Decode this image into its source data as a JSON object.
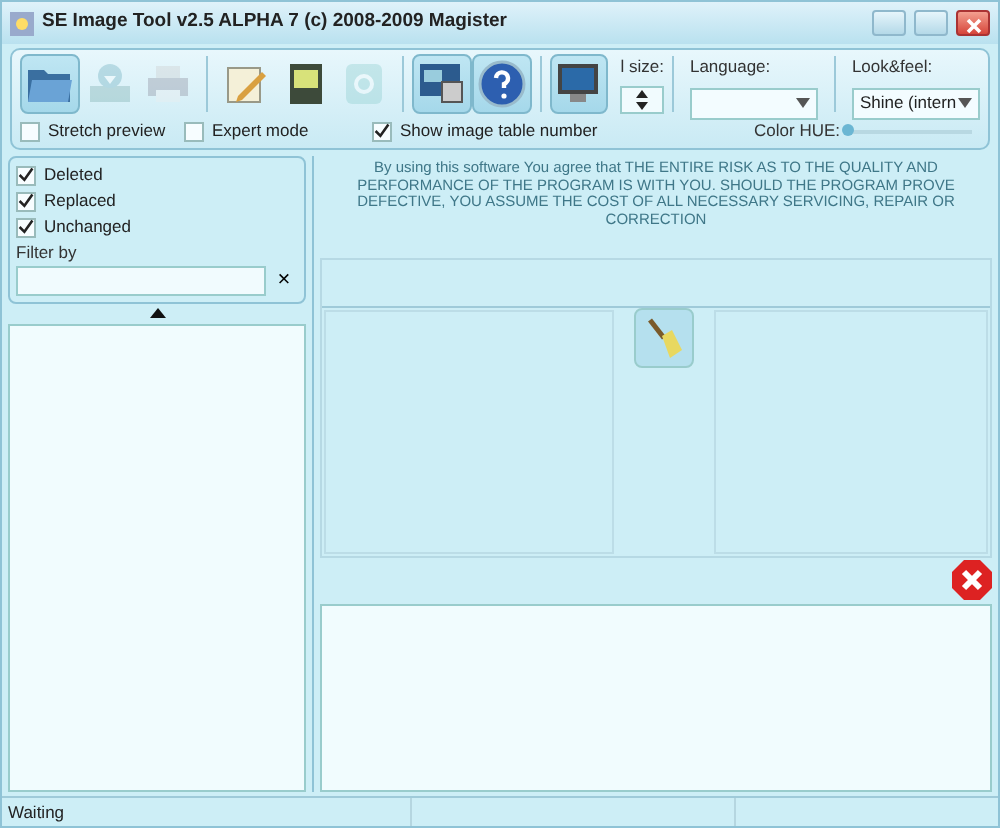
{
  "window": {
    "title": "SE Image Tool v2.5 ALPHA 7 (c) 2008-2009 Magister"
  },
  "toolbar": {
    "groups": [
      [
        {
          "kind": "open",
          "disabled": false,
          "pressed": true
        },
        {
          "kind": "import",
          "disabled": true,
          "pressed": false
        },
        {
          "kind": "print",
          "disabled": true,
          "pressed": false
        }
      ],
      [
        {
          "kind": "edit",
          "disabled": false,
          "pressed": false
        },
        {
          "kind": "save",
          "disabled": false,
          "pressed": false
        },
        {
          "kind": "refresh",
          "disabled": true,
          "pressed": false
        }
      ],
      [
        {
          "kind": "screens",
          "disabled": false,
          "pressed": true
        },
        {
          "kind": "help",
          "disabled": false,
          "pressed": true
        }
      ],
      [
        {
          "kind": "monitor",
          "disabled": false,
          "pressed": true
        }
      ]
    ],
    "size_label": "l size:",
    "language": {
      "label": "Language:"
    },
    "look_and_feel": {
      "label": "Look&feel:",
      "value": "Shine (intern"
    },
    "color_hue": {
      "label": "Color HUE:",
      "level": 0.0
    }
  },
  "options": [
    {
      "label": "Stretch preview",
      "checked": false
    },
    {
      "label": "Expert mode",
      "checked": false
    },
    {
      "label": "Show image table number",
      "checked": true
    }
  ],
  "filters": [
    {
      "label": "Deleted",
      "checked": true
    },
    {
      "label": "Replaced",
      "checked": true
    },
    {
      "label": "Unchanged",
      "checked": true
    }
  ],
  "filter_by": {
    "label": "Filter by",
    "clear": "×"
  },
  "disclaimer": "By using this software You agree that THE ENTIRE RISK AS TO THE QUALITY AND PERFORMANCE OF THE PROGRAM IS WITH YOU. SHOULD THE PROGRAM PROVE DEFECTIVE, YOU ASSUME THE COST OF ALL NECESSARY SERVICING, REPAIR OR CORRECTION",
  "status_bar": {
    "text": "Waiting"
  }
}
